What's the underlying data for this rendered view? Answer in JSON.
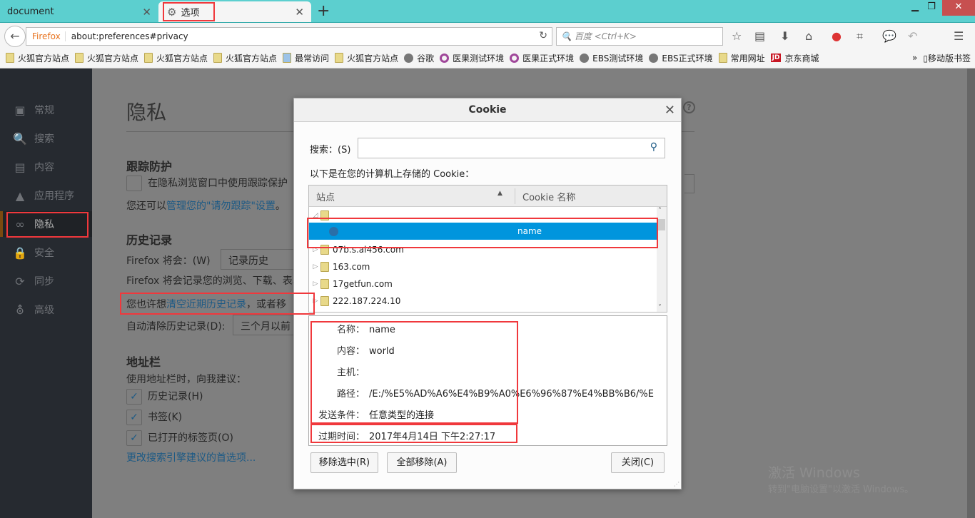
{
  "tabs": [
    {
      "label": "document"
    },
    {
      "label": "选项"
    }
  ],
  "nav": {
    "brand": "Firefox",
    "url": "about:preferences#privacy",
    "search_placeholder": "百度 <Ctrl+K>"
  },
  "bookmarks": [
    {
      "label": "火狐官方站点",
      "icon": "folder"
    },
    {
      "label": "火狐官方站点",
      "icon": "folder"
    },
    {
      "label": "火狐官方站点",
      "icon": "folder"
    },
    {
      "label": "火狐官方站点",
      "icon": "folder"
    },
    {
      "label": "最常访问",
      "icon": "smart-folder"
    },
    {
      "label": "火狐官方站点",
      "icon": "folder"
    },
    {
      "label": "谷歌",
      "icon": "globe"
    },
    {
      "label": "医果测试环境",
      "icon": "ring"
    },
    {
      "label": "医果正式环境",
      "icon": "ring"
    },
    {
      "label": "EBS测试环境",
      "icon": "globe"
    },
    {
      "label": "EBS正式环境",
      "icon": "globe"
    },
    {
      "label": "常用网址",
      "icon": "folder"
    },
    {
      "label": "京东商城",
      "icon": "jd"
    }
  ],
  "bookmarks_more": "»",
  "mobile_bookmarks": "移动版书签",
  "sidebar": {
    "items": [
      {
        "label": "常规",
        "icon": "general-icon"
      },
      {
        "label": "搜索",
        "icon": "search-icon"
      },
      {
        "label": "内容",
        "icon": "document-icon"
      },
      {
        "label": "应用程序",
        "icon": "rocket-icon"
      },
      {
        "label": "隐私",
        "icon": "mask-icon"
      },
      {
        "label": "安全",
        "icon": "lock-icon"
      },
      {
        "label": "同步",
        "icon": "sync-icon"
      },
      {
        "label": "高级",
        "icon": "wizard-hat-icon"
      }
    ]
  },
  "content": {
    "title": "隐私",
    "tracking_heading": "跟踪防护",
    "tracking_checkbox": "在隐私浏览窗口中使用跟踪保护",
    "dnt_prefix": "您还可以",
    "dnt_link": "管理您的\"请勿跟踪\"设置",
    "dnt_suffix": "。",
    "history_heading": "历史记录",
    "firefox_will": "Firefox 将会：(W)",
    "history_mode": "记录历史",
    "history_desc": "Firefox 将会记录您的浏览、下载、表单和搜索历史。",
    "clear_prefix": "您也许想",
    "clear_link": "清空近期历史记录",
    "clear_suffix": "，或者移",
    "auto_clear": "自动清除历史记录(D):",
    "auto_clear_value": "三个月以前",
    "urlbar_heading": "地址栏",
    "urlbar_desc": "使用地址栏时，向我建议：",
    "checks": [
      {
        "label": "历史记录(H)",
        "checked": true
      },
      {
        "label": "书签(K)",
        "checked": true
      },
      {
        "label": "已打开的标签页(O)",
        "checked": true
      }
    ],
    "change_search_link": "更改搜索引擎建议的首选项..."
  },
  "dialog": {
    "title": "Cookie",
    "search_label": "搜索：(S)",
    "stored_label": "以下是在您的计算机上存储的 Cookie：",
    "col_site": "站点",
    "col_name": "Cookie 名称",
    "rows": [
      {
        "site": "",
        "name": "",
        "type": "folder",
        "open": true
      },
      {
        "site": "",
        "name": "name",
        "type": "cookie",
        "selected": true
      },
      {
        "site": "07b.s.al456.com",
        "type": "folder"
      },
      {
        "site": "163.com",
        "type": "folder"
      },
      {
        "site": "17getfun.com",
        "type": "folder"
      },
      {
        "site": "222.187.224.10",
        "type": "folder"
      }
    ],
    "details": [
      {
        "key": "名称：",
        "value": "name"
      },
      {
        "key": "内容：",
        "value": "world"
      },
      {
        "key": "主机：",
        "value": ""
      },
      {
        "key": "路径：",
        "value": "/E:/%E5%AD%A6%E4%B9%A0%E6%96%87%E4%BB%B6/%E"
      },
      {
        "key": "发送条件：",
        "value": "任意类型的连接"
      },
      {
        "key": "过期时间：",
        "value": "2017年4月14日 下午2:27:17"
      }
    ],
    "remove_selected": "移除选中(R)",
    "remove_all": "全部移除(A)",
    "close": "关闭(C)"
  },
  "watermark": {
    "line1": "激活 Windows",
    "line2": "转到\"电脑设置\"以激活 Windows。"
  },
  "colors": {
    "tabbar": "#5ccfcf",
    "selection": "#0095dd",
    "highlight": "#f0383c",
    "link": "#1d5a85"
  }
}
